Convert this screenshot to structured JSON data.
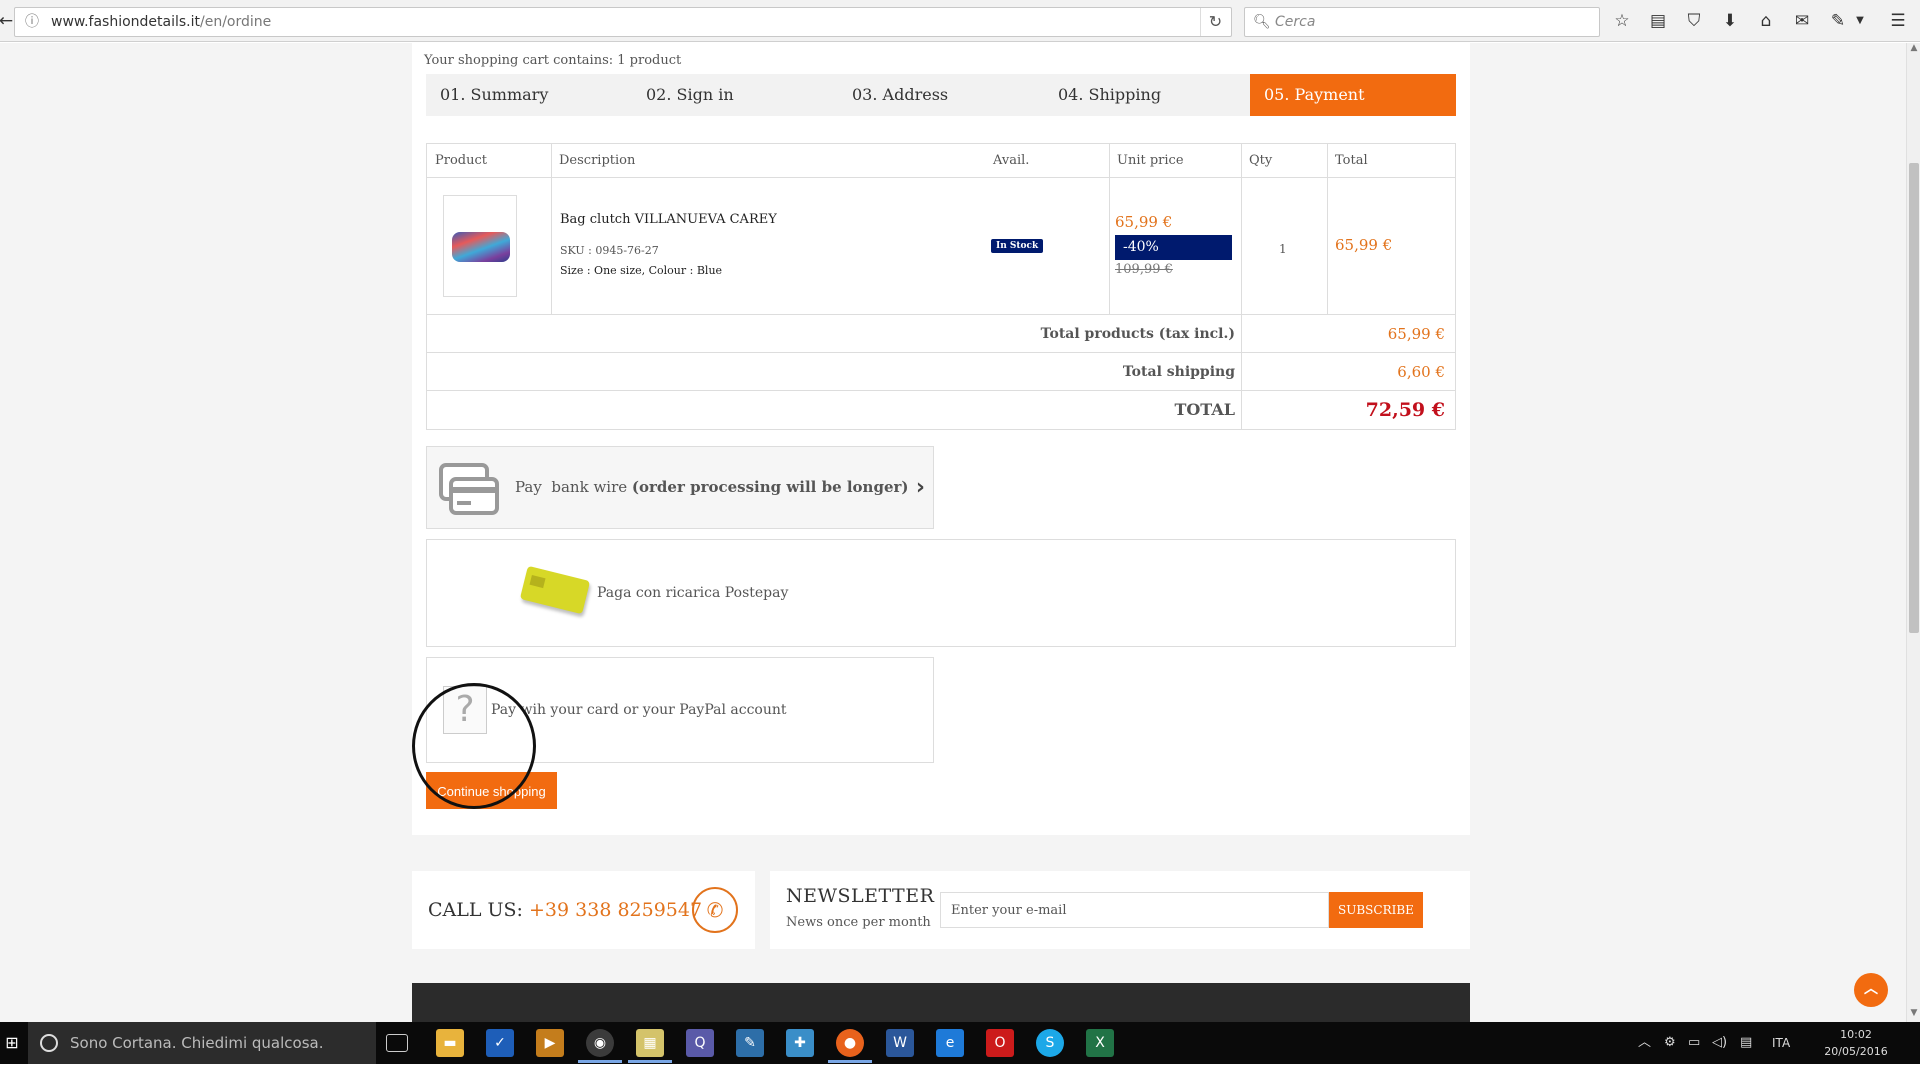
{
  "browser": {
    "url_domain": "www.fashiondetails.it",
    "url_path": "/en/ordine",
    "search_placeholder": "Cerca"
  },
  "cart": {
    "summary_text": "Your shopping cart contains: 1 product",
    "steps": [
      "01. Summary",
      "02. Sign in",
      "03. Address",
      "04. Shipping",
      "05. Payment"
    ],
    "active_step": 4,
    "columns": [
      "Product",
      "Description",
      "Avail.",
      "Unit price",
      "Qty",
      "Total"
    ],
    "item": {
      "name": "Bag clutch VILLANUEVA CAREY",
      "sku": "SKU : 0945-76-27",
      "attributes": "Size : One size, Colour : Blue",
      "availability": "In Stock",
      "price": "65,99 €",
      "discount": "-40%",
      "old_price": "109,99 €",
      "qty": "1",
      "total": "65,99 €"
    },
    "summary": [
      {
        "label": "Total products (tax incl.)",
        "value": "65,99 €"
      },
      {
        "label": "Total shipping",
        "value": "6,60 €"
      },
      {
        "label": "TOTAL",
        "value": "72,59 €"
      }
    ]
  },
  "payment": {
    "bankwire_prefix": "Pay",
    "bankwire_main": "bank wire",
    "bankwire_note": "(order processing will be longer)",
    "postepay": "Paga con ricarica Postepay",
    "paypal_pre": "Pay wi",
    "paypal_post": "h your card or your PayPal account",
    "continue": "Continue shopping"
  },
  "footer": {
    "call_label": "CALL US:",
    "phone": "+39 338 8259547",
    "newsletter_title": "NEWSLETTER",
    "newsletter_sub": "News once per month",
    "email_placeholder": "Enter your e-mail",
    "subscribe": "SUBSCRIBE"
  },
  "taskbar": {
    "cortana": "Sono Cortana. Chiedimi qualcosa.",
    "lang": "ITA",
    "time": "10:02",
    "date": "20/05/2016"
  },
  "colors": {
    "accent": "#f26b10",
    "price": "#e2731c",
    "total": "#c2101c",
    "badge": "#001a6e"
  }
}
